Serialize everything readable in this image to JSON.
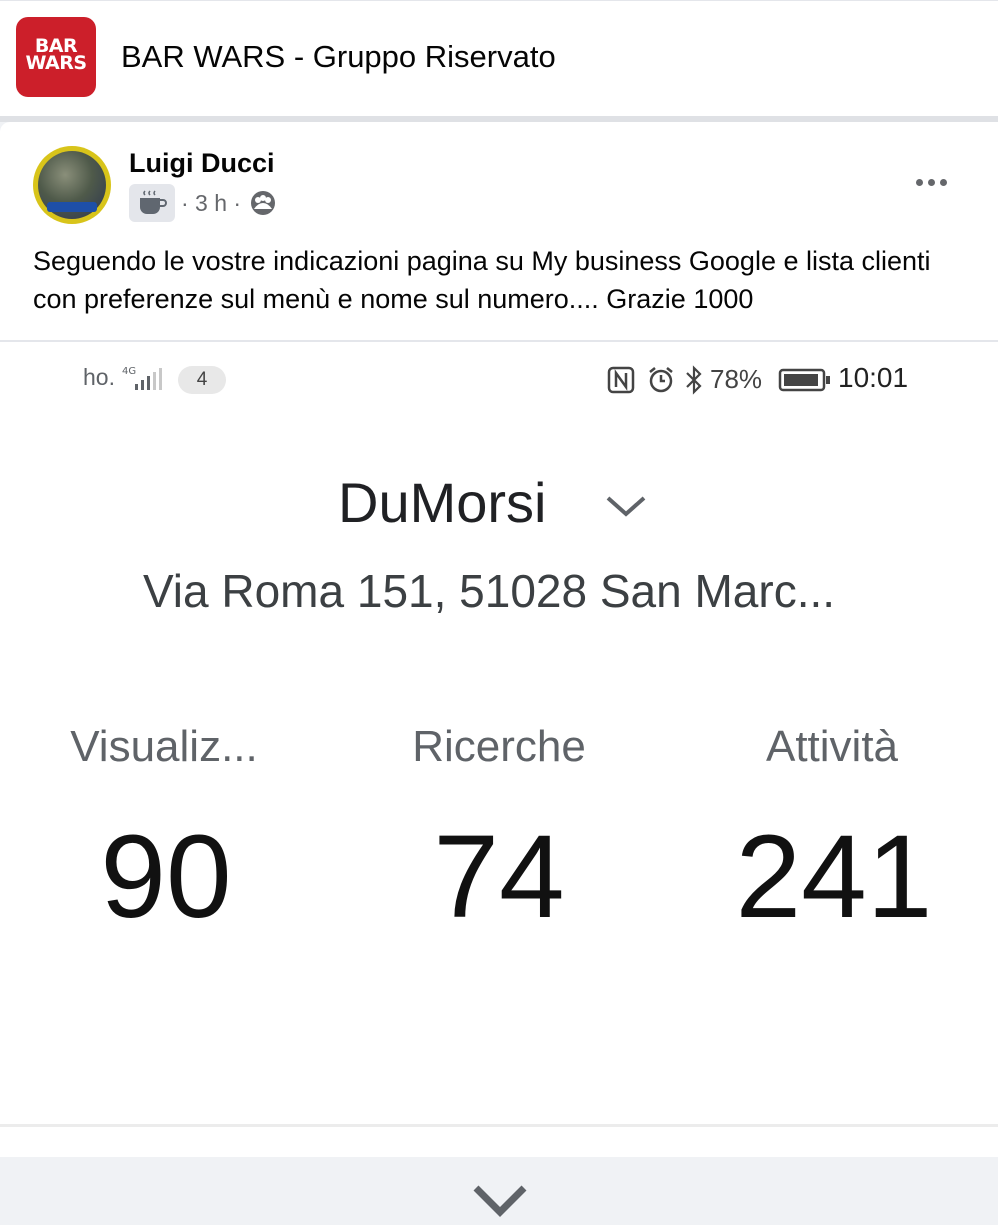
{
  "group": {
    "name": "BAR WARS - Gruppo Riservato",
    "logo_line1": "BAR",
    "logo_line2": "WARS"
  },
  "post": {
    "author": "Luigi Ducci",
    "time": "· 3 h ·",
    "text": "Seguendo le vostre indicazioni pagina su My business Google e lista clienti con preferenze sul menù e nome sul numero.... Grazie 1000",
    "icons": {
      "badge": "coffee-cup-icon",
      "privacy": "group-members-icon",
      "more": "more-options-icon"
    }
  },
  "screenshot": {
    "status_bar": {
      "carrier": "ho.",
      "signal": "4G",
      "notifications": "4",
      "battery_percent": "78%",
      "time": "10:01"
    },
    "business": {
      "name": "DuMorsi",
      "address": "Via Roma 151, 51028 San Marc..."
    },
    "stats": [
      {
        "label": "Visualiz...",
        "value": "90"
      },
      {
        "label": "Ricerche",
        "value": "74"
      },
      {
        "label": "Attività",
        "value": "241"
      }
    ]
  },
  "colors": {
    "logo_red": "#cc1f2a",
    "text_primary": "#050505",
    "text_secondary": "#65676b",
    "page_bg": "#f0f2f5"
  }
}
